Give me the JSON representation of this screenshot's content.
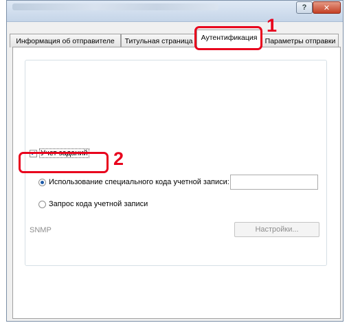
{
  "window": {
    "help_glyph": "?",
    "close_glyph": "✕"
  },
  "tabs": [
    {
      "label": "Информация об отправителе",
      "active": false
    },
    {
      "label": "Титульная страница",
      "active": false
    },
    {
      "label": "Аутентификация",
      "active": true
    },
    {
      "label": "Параметры отправки",
      "active": false
    }
  ],
  "auth": {
    "job_accounting_label": "Учет заданий",
    "job_accounting_checked": true,
    "use_specific_code_label": "Использование специального кода учетной записи:",
    "use_specific_code_selected": true,
    "account_code_value": "",
    "prompt_code_label": "Запрос кода учетной записи",
    "prompt_code_selected": false,
    "snmp_label": "SNMP",
    "settings_button": "Настройки..."
  },
  "callouts": [
    {
      "number": "1"
    },
    {
      "number": "2"
    }
  ],
  "colors": {
    "callout": "#e8001c",
    "radio_accent": "#1c5aa8"
  }
}
